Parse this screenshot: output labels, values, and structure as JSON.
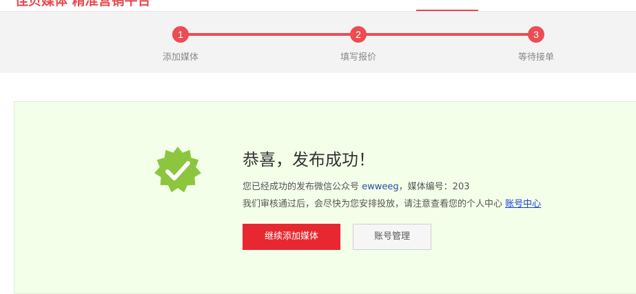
{
  "header": {
    "site_title": "佳贝媒体 精准营销平台"
  },
  "steps": [
    {
      "number": "1",
      "label": "添加媒体"
    },
    {
      "number": "2",
      "label": "填写报价"
    },
    {
      "number": "3",
      "label": "等待接单"
    }
  ],
  "success": {
    "title": "恭喜，发布成功！",
    "line1_prefix": "您已经成功的发布微信公众号",
    "account_name": "ewweeg",
    "line1_suffix": "，媒体编号：203",
    "line2_text": "我们审核通过后，会尽快为您安排投放，请注意查看您的个人中心",
    "account_center_link": "账号中心",
    "continue_button": "继续添加媒体",
    "manage_button": "账号管理"
  },
  "colors": {
    "accent": "#ea4d52",
    "primary_button": "#e72830",
    "success_bg": "#f3ffe9",
    "badge_green": "#8cc63f"
  }
}
